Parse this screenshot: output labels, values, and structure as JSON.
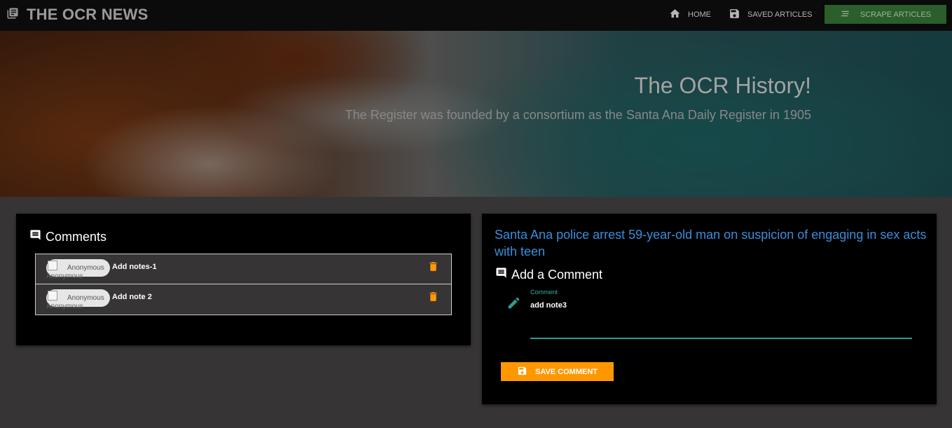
{
  "nav": {
    "brand": "THE OCR NEWS",
    "brand_icon": "newspaper-icon",
    "home": "HOME",
    "home_icon": "home-icon",
    "saved": "SAVED ARTICLES",
    "saved_icon": "floppy-disk-icon",
    "scrape": "SCRAPE ARTICLES",
    "scrape_icon": "list-lines-icon",
    "scrape_color": "#2a5e2a"
  },
  "hero": {
    "title": "The OCR History!",
    "subtitle": "The Register was founded by a consortium as the Santa Ana Daily Register in 1905"
  },
  "comments": {
    "title": "Comments",
    "title_icon": "comment-icon",
    "items": [
      {
        "avatar_label": "Anonymous",
        "avatar_alt": "Anonymous",
        "text": "Add notes-1",
        "delete_icon": "trash-icon"
      },
      {
        "avatar_label": "Anonymous",
        "avatar_alt": "Anonymous",
        "text": "Add note 2",
        "delete_icon": "trash-icon"
      }
    ],
    "delete_color": "#ff9800"
  },
  "article": {
    "headline": "Santa Ana police arrest 59-year-old man on suspicion of engaging in sex acts with teen",
    "headline_color": "#3a8edb"
  },
  "add_comment": {
    "title": "Add a Comment",
    "title_icon": "comment-icon",
    "field_icon": "pencil-icon",
    "field_label": "Comment",
    "field_value": "add note3",
    "accent_color": "#2a9d92",
    "save_label": "SAVE COMMENT",
    "save_icon": "floppy-disk-icon",
    "save_color": "#ff9800"
  }
}
